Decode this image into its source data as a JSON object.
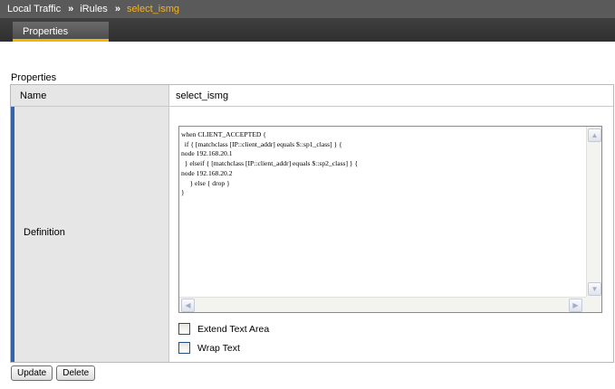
{
  "breadcrumb": {
    "items": [
      "Local Traffic",
      "iRules"
    ],
    "separator": "»",
    "current": "select_ismg"
  },
  "tabs": [
    {
      "label": "Properties",
      "active": true
    }
  ],
  "section_title": "Properties",
  "properties": {
    "name_label": "Name",
    "name_value": "select_ismg",
    "definition_label": "Definition",
    "definition_code": "when CLIENT_ACCEPTED {\n  if { [matchclass [IP::client_addr] equals $::sp1_class] } {\nnode 192.168.20.1\n  } elseif { [matchclass [IP::client_addr] equals $::sp2_class] } {\nnode 192.168.20.2\n     } else { drop }\n}"
  },
  "options": {
    "extend_label": "Extend Text Area",
    "wrap_label": "Wrap Text"
  },
  "buttons": {
    "update_label": "Update",
    "delete_label": "Delete"
  },
  "colors": {
    "header_bg": "#5a5a5a",
    "current_crumb": "#f5b323",
    "tab_underline": "#f2b705",
    "row_accent": "#3366a9"
  }
}
